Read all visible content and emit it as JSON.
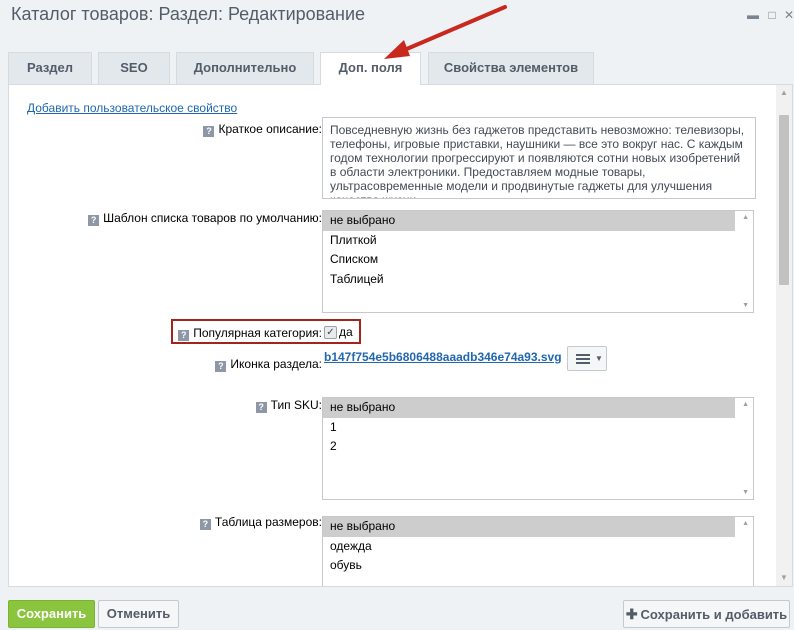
{
  "window": {
    "title": "Каталог товаров: Раздел: Редактирование",
    "minimize_icon": "window-minimize-icon",
    "maximize_icon": "window-maximize-icon",
    "close_icon": "window-close-icon"
  },
  "tabs": [
    {
      "label": "Раздел"
    },
    {
      "label": "SEO"
    },
    {
      "label": "Дополнительно"
    },
    {
      "label": "Доп. поля"
    },
    {
      "label": "Свойства элементов"
    }
  ],
  "form": {
    "add_property_link": "Добавить пользовательское свойство",
    "short_description": {
      "label": "Краткое описание:",
      "value": "Повседневную жизнь без гаджетов представить невозможно: телевизоры, телефоны, игровые приставки, наушники — все это вокруг нас. С каждым годом технологии прогрессируют и появляются сотни новых изобретений в области электроники. Предоставляем модные товары, ультрасовременные модели и продвинутые гаджеты для улучшения качества жизни."
    },
    "list_template": {
      "label": "Шаблон списка товаров по умолчанию:",
      "options": [
        "не выбрано",
        "Плиткой",
        "Списком",
        "Таблицей"
      ]
    },
    "popular": {
      "label": "Популярная категория:",
      "checkbox_label": "да"
    },
    "section_icon": {
      "label": "Иконка раздела:",
      "file": "b147f754e5b6806488aaadb346e74a93.svg"
    },
    "sku_type": {
      "label": "Тип SKU:",
      "options": [
        "не выбрано",
        "1",
        "2"
      ]
    },
    "size_table": {
      "label": "Таблица размеров:",
      "options": [
        "не выбрано",
        "одежда",
        "обувь"
      ]
    }
  },
  "footer": {
    "save": "Сохранить",
    "cancel": "Отменить",
    "save_add": "Сохранить и добавить"
  },
  "colors": {
    "accent_green": "#8bc53f",
    "link_blue": "#2067b0",
    "highlight_red": "#a3231d",
    "annotation_arrow": "#c8281e"
  }
}
